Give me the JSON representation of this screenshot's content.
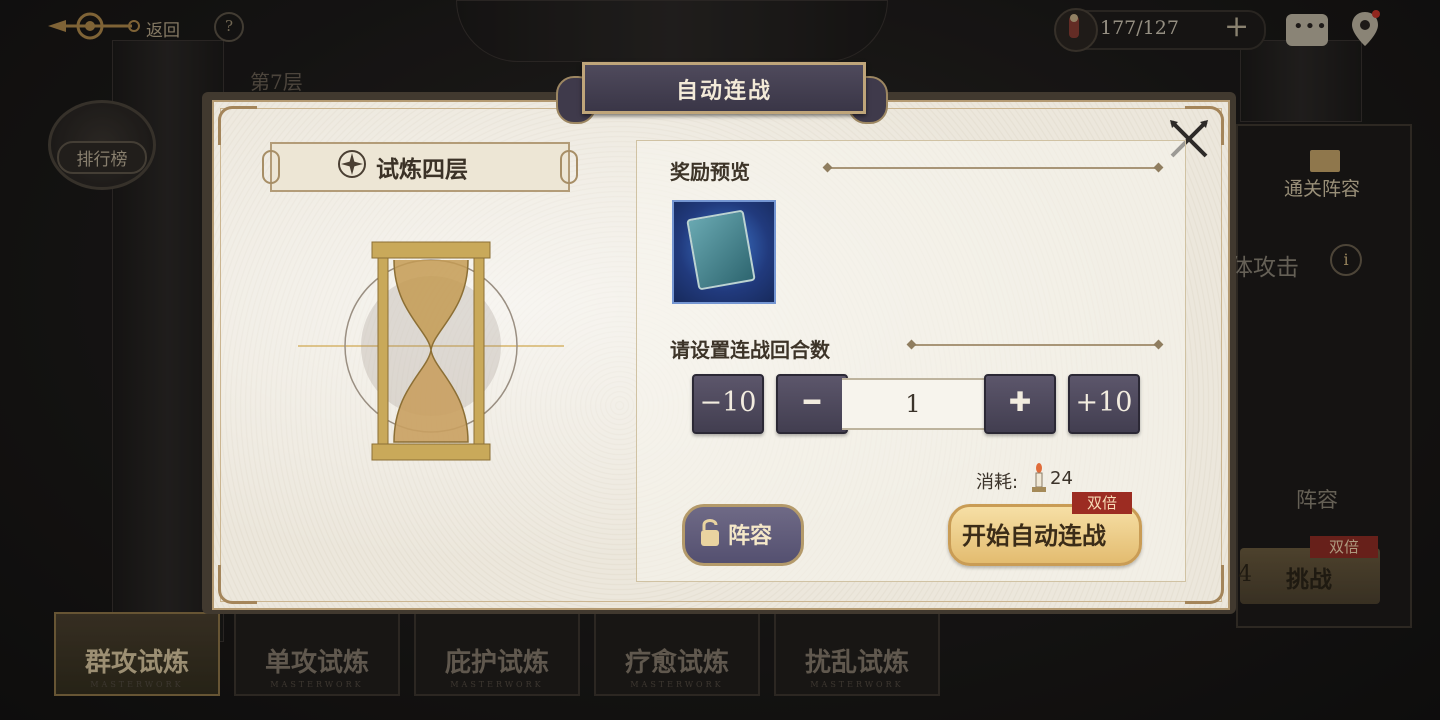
{
  "topbar": {
    "back_label": "返回",
    "help": "?",
    "floor": "第7层",
    "resource_value": "177/127",
    "plus": "+"
  },
  "leaderboard": {
    "label": "排行榜"
  },
  "right_panel": {
    "title": "通关阵容",
    "attack_label": "体攻击",
    "info": "i",
    "lineup_label": "阵容",
    "challenge_label": "挑战",
    "challenge_prefix": "4",
    "double_label": "双倍"
  },
  "bottom_tabs": [
    {
      "label": "群攻试炼",
      "sub": "MASTERWORK",
      "active": true
    },
    {
      "label": "单攻试炼",
      "sub": "MASTERWORK",
      "active": false
    },
    {
      "label": "庇护试炼",
      "sub": "MASTERWORK",
      "active": false
    },
    {
      "label": "疗愈试炼",
      "sub": "MASTERWORK",
      "active": false
    },
    {
      "label": "扰乱试炼",
      "sub": "MASTERWORK",
      "active": false
    }
  ],
  "modal": {
    "title": "自动连战",
    "stage_title": "试炼四层",
    "reward_preview_label": "奖励预览",
    "rounds_label": "请设置连战回合数",
    "minus10_label": "−10",
    "minus_label": "━",
    "count_value": "1",
    "plus_label": "✚",
    "plus10_label": "+10",
    "cost_label": "消耗:",
    "cost_value": "24",
    "lineup_label": "阵容",
    "start_label": "开始自动连战",
    "double_label": "双倍"
  },
  "icons": {
    "back": "ornate-back-icon",
    "resource": "doll-icon",
    "chat": "chat-icon",
    "map": "map-pin-icon",
    "close": "crossed-swords-close-icon",
    "stage": "emblem-icon",
    "hourglass": "hourglass-icon",
    "reward": "tarot-card-icon",
    "cost": "candle-icon",
    "lock": "lock-icon"
  },
  "colors": {
    "modal_frame": "#41392f",
    "paper": "#ece7dc",
    "button_purple": "#5c566b",
    "start_gold": "#e3bc70",
    "badge_red": "#9c2c22"
  }
}
